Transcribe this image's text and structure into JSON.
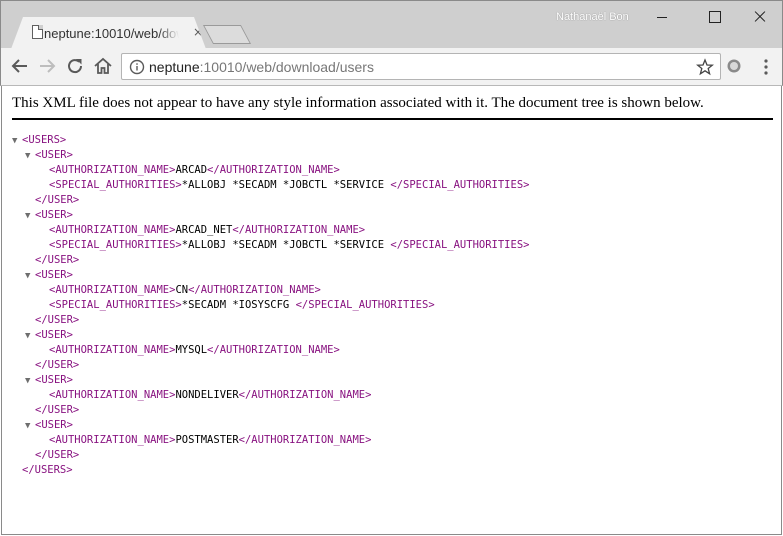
{
  "window": {
    "tab_title": "neptune:10010/web/dow",
    "profile_name": "Nathanaël Bon",
    "close_tab_glyph": "×"
  },
  "toolbar": {
    "url_host": "neptune",
    "url_rest": ":10010/web/download/users",
    "icons": [
      "back-arrow-icon",
      "forward-arrow-icon",
      "reload-icon",
      "home-icon",
      "info-icon",
      "bookmark-star-icon",
      "extension-icon",
      "menu-icon"
    ]
  },
  "page": {
    "notice": "This XML file does not appear to have any style information associated with it. The document tree is shown below.",
    "root_open": "<USERS>",
    "root_close": "</USERS>",
    "user_open": "<USER>",
    "user_close": "</USER>",
    "auth_open": "<AUTHORIZATION_NAME>",
    "auth_close": "</AUTHORIZATION_NAME>",
    "spec_open": "<SPECIAL_AUTHORITIES>",
    "spec_close": "</SPECIAL_AUTHORITIES>",
    "users": [
      {
        "name": "ARCAD",
        "special": "*ALLOBJ *SECADM *JOBCTL *SERVICE "
      },
      {
        "name": "ARCAD_NET",
        "special": "*ALLOBJ *SECADM *JOBCTL *SERVICE "
      },
      {
        "name": "CN",
        "special": "*SECADM *IOSYSCFG "
      },
      {
        "name": "MYSQL"
      },
      {
        "name": "NONDELIVER"
      },
      {
        "name": "POSTMASTER"
      }
    ]
  },
  "colors": {
    "tag": "#881280",
    "text": "#000000",
    "chrome": "#cfcfcf",
    "toolbar": "#f2f2f2"
  }
}
